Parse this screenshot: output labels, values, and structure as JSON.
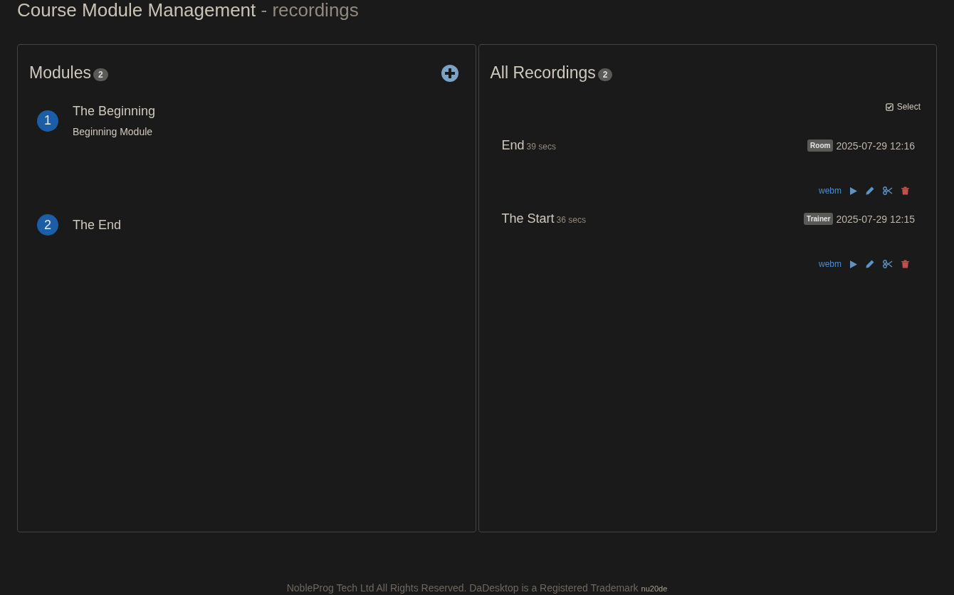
{
  "page": {
    "title": "Course Module Management",
    "subtitle": "- recordings"
  },
  "modules": {
    "title": "Modules",
    "count": "2",
    "items": [
      {
        "number": "1",
        "title": "The Beginning",
        "description": "Beginning Module"
      },
      {
        "number": "2",
        "title": "The End"
      }
    ]
  },
  "recordings": {
    "title": "All Recordings",
    "count": "2",
    "select_label": "Select",
    "items": [
      {
        "title": "End",
        "duration": "39 secs",
        "tag": "Room",
        "date": "2025-07-29 12:16",
        "format": "webm"
      },
      {
        "title": "The Start",
        "duration": "36 secs",
        "tag": "Trainer",
        "date": "2025-07-29 12:15",
        "format": "webm"
      }
    ]
  },
  "footer": {
    "text": "NobleProg Tech Ltd All Rights Reserved. DaDesktop is a Registered Trademark",
    "version": "nu20de"
  }
}
